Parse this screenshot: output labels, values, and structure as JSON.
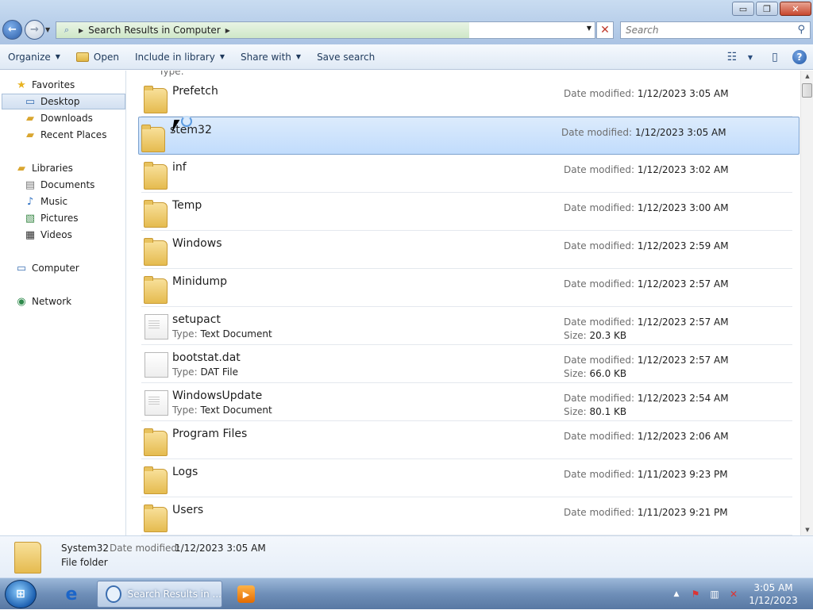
{
  "window": {
    "controls": {
      "minimize": "▭",
      "maximize": "❐",
      "close": "✕"
    }
  },
  "address_bar": {
    "crumb": "Search Results in Computer",
    "stop": "✕"
  },
  "search": {
    "placeholder": "Search"
  },
  "toolbar": {
    "organize": "Organize",
    "open": "Open",
    "include_in_library": "Include in library",
    "share_with": "Share with",
    "save_search": "Save search",
    "help": "?"
  },
  "nav": {
    "favorites": "Favorites",
    "desktop": "Desktop",
    "downloads": "Downloads",
    "recent_places": "Recent Places",
    "libraries": "Libraries",
    "documents": "Documents",
    "music": "Music",
    "pictures": "Pictures",
    "videos": "Videos",
    "computer": "Computer",
    "network": "Network"
  },
  "results": {
    "partial_type_label": "Type:",
    "type_label": "Type:",
    "date_label": "Date modified:",
    "size_label": "Size:",
    "items": [
      {
        "name": "Prefetch",
        "kind": "folder",
        "date": "1/12/2023 3:05 AM"
      },
      {
        "name": "System32",
        "display": "stem32",
        "kind": "folder",
        "date": "1/12/2023 3:05 AM",
        "selected": true
      },
      {
        "name": "inf",
        "kind": "folder",
        "date": "1/12/2023 3:02 AM"
      },
      {
        "name": "Temp",
        "kind": "folder",
        "date": "1/12/2023 3:00 AM"
      },
      {
        "name": "Windows",
        "kind": "folder",
        "date": "1/12/2023 2:59 AM"
      },
      {
        "name": "Minidump",
        "kind": "folder",
        "date": "1/12/2023 2:57 AM"
      },
      {
        "name": "setupact",
        "kind": "doc",
        "type": "Text Document",
        "date": "1/12/2023 2:57 AM",
        "size": "20.3 KB"
      },
      {
        "name": "bootstat.dat",
        "kind": "plain",
        "type": "DAT File",
        "date": "1/12/2023 2:57 AM",
        "size": "66.0 KB"
      },
      {
        "name": "WindowsUpdate",
        "kind": "doc",
        "type": "Text Document",
        "date": "1/12/2023 2:54 AM",
        "size": "80.1 KB"
      },
      {
        "name": "Program Files",
        "kind": "folder",
        "date": "1/12/2023 2:06 AM"
      },
      {
        "name": "Logs",
        "kind": "folder",
        "date": "1/11/2023 9:23 PM"
      },
      {
        "name": "Users",
        "kind": "folder",
        "date": "1/11/2023 9:21 PM"
      }
    ]
  },
  "details_pane": {
    "name": "System32",
    "date_label": "Date modified:",
    "date": "1/12/2023 3:05 AM",
    "type": "File folder"
  },
  "taskbar": {
    "explorer_task": "Search Results in ...",
    "time": "3:05 AM",
    "date": "1/12/2023"
  }
}
